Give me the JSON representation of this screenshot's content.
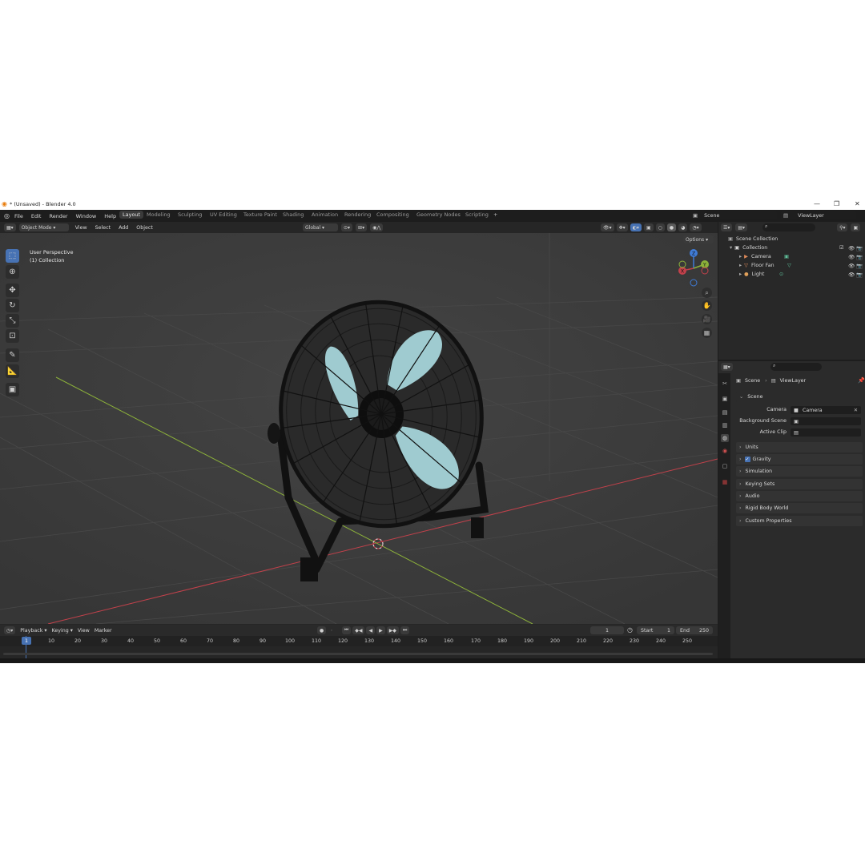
{
  "window": {
    "title": "* (Unsaved) - Blender 4.0"
  },
  "menu": [
    "File",
    "Edit",
    "Render",
    "Window",
    "Help"
  ],
  "workspaces": [
    "Layout",
    "Modeling",
    "Sculpting",
    "UV Editing",
    "Texture Paint",
    "Shading",
    "Animation",
    "Rendering",
    "Compositing",
    "Geometry Nodes",
    "Scripting"
  ],
  "active_workspace": "Layout",
  "scene": {
    "name": "Scene",
    "view_layer": "ViewLayer"
  },
  "viewport_header": {
    "mode": "Object Mode",
    "menus": [
      "View",
      "Select",
      "Add",
      "Object"
    ],
    "transform_orientation": "Global",
    "options": "Options"
  },
  "viewport": {
    "overlay_line1": "User Perspective",
    "overlay_line2": "(1) Collection",
    "gizmo_axes": [
      "Z",
      "Y",
      "X"
    ]
  },
  "outliner": {
    "root": "Scene Collection",
    "collection": "Collection",
    "items": [
      "Camera",
      "Floor Fan",
      "Light"
    ]
  },
  "properties": {
    "breadcrumb": [
      "Scene",
      "ViewLayer"
    ],
    "section": "Scene",
    "fields": [
      {
        "label": "Camera",
        "value": "Camera"
      },
      {
        "label": "Background Scene",
        "value": ""
      },
      {
        "label": "Active Clip",
        "value": ""
      }
    ],
    "panels": [
      "Units",
      "Gravity",
      "Simulation",
      "Keying Sets",
      "Audio",
      "Rigid Body World",
      "Custom Properties"
    ]
  },
  "timeline": {
    "menus": [
      "Playback",
      "Keying",
      "View",
      "Marker"
    ],
    "current_frame": "1",
    "start_label": "Start",
    "start": "1",
    "end_label": "End",
    "end": "250",
    "ticks": [
      "1",
      "10",
      "20",
      "30",
      "40",
      "50",
      "60",
      "70",
      "80",
      "90",
      "100",
      "110",
      "120",
      "130",
      "140",
      "150",
      "160",
      "170",
      "180",
      "190",
      "200",
      "210",
      "220",
      "230",
      "240",
      "250"
    ]
  },
  "colors": {
    "accent": "#4772b3",
    "x_axis": "#c2414b",
    "y_axis": "#8cb13a",
    "z_axis": "#3f7bd6",
    "fan_blade": "#9fcbd0"
  }
}
